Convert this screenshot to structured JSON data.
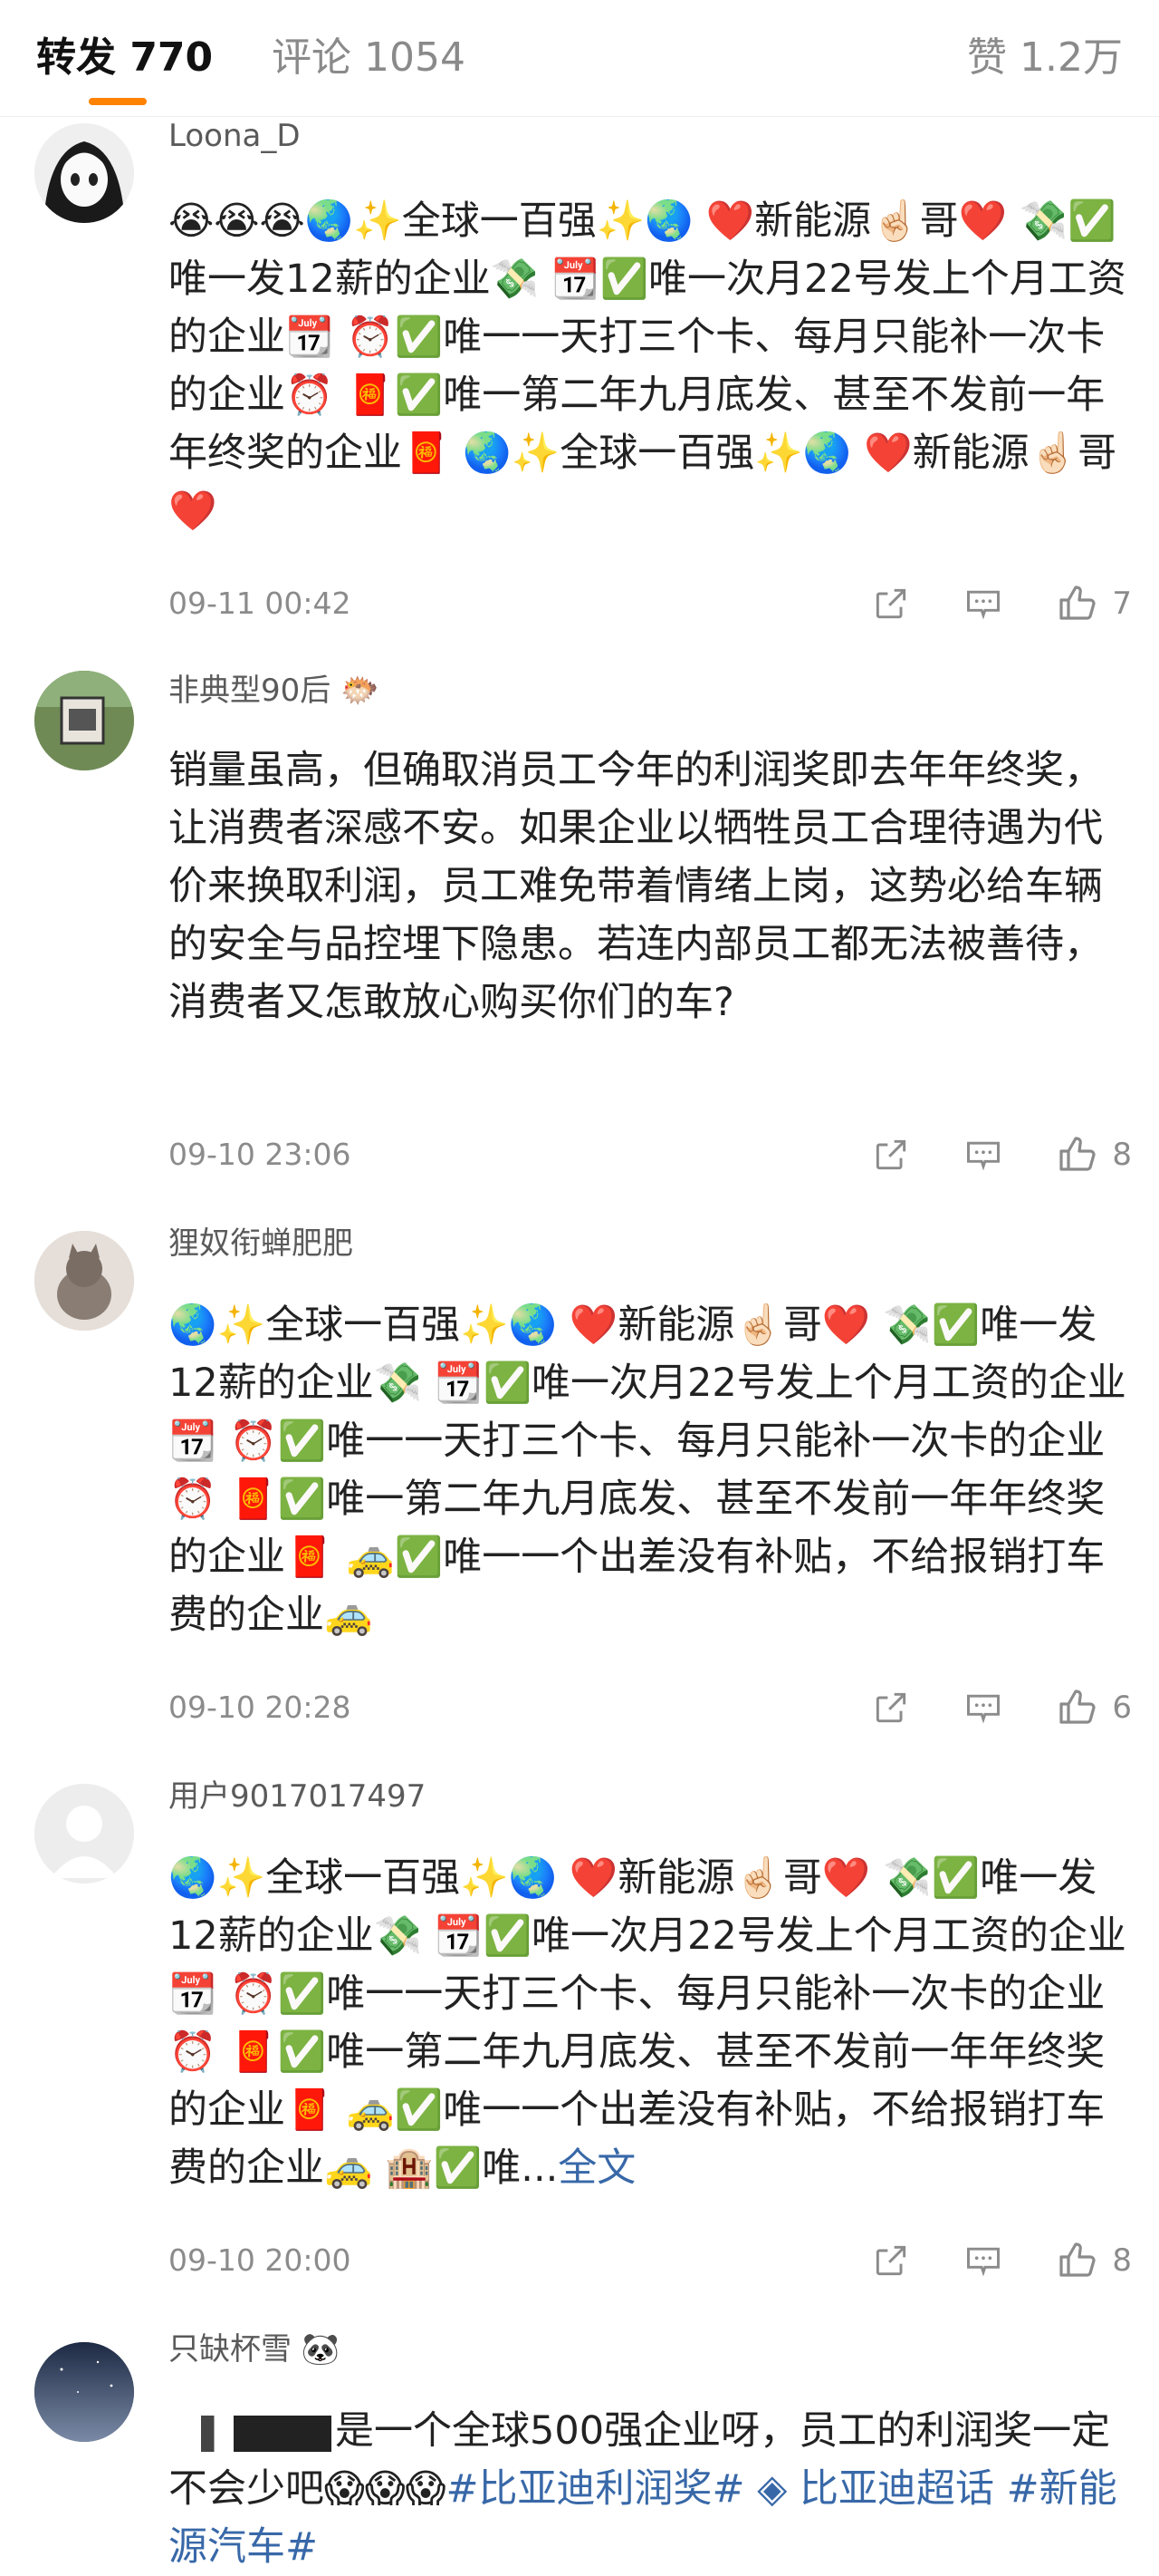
{
  "tabs": {
    "repost": "转发 770",
    "comment": "评论 1054",
    "like": "赞 1.2万"
  },
  "colors": {
    "accent": "#ff8200",
    "link": "#3868a8"
  },
  "comments": [
    {
      "username": "Loona_D",
      "avatar_icon": "anime-girl-avatar",
      "text": "😭😭😭🌏✨全球一百强✨🌏 ❤️新能源☝🏻哥❤️ 💸✅唯一发12薪的企业💸 📆✅唯一次月22号发上个月工资的企业📆 ⏰✅唯一一天打三个卡、每月只能补一次卡的企业⏰ 🧧✅唯一第二年九月底发、甚至不发前一年年终奖的企业🧧 🌏✨全球一百强✨🌏 ❤️新能源☝🏻哥❤️",
      "time": "09-11 00:42",
      "likes": "7"
    },
    {
      "username": "非典型90后 🐡",
      "avatar_icon": "photo-avatar",
      "text": "销量虽高，但确取消员工今年的利润奖即去年年终奖，让消费者深感不安。如果企业以牺牲员工合理待遇为代价来换取利润，员工难免带着情绪上岗，这势必给车辆的安全与品控埋下隐患。若连内部员工都无法被善待，消费者又怎敢放心购买你们的车?",
      "time": "09-10 23:06",
      "likes": "8"
    },
    {
      "username": "狸奴衔蝉肥肥",
      "avatar_icon": "cat-avatar",
      "text": "🌏✨全球一百强✨🌏 ❤️新能源☝🏻哥❤️ 💸✅唯一发12薪的企业💸 📆✅唯一次月22号发上个月工资的企业📆 ⏰✅唯一一天打三个卡、每月只能补一次卡的企业⏰ 🧧✅唯一第二年九月底发、甚至不发前一年年终奖的企业🧧 🚕✅唯一一个出差没有补贴，不给报销打车费的企业🚕",
      "time": "09-10 20:28",
      "likes": "6"
    },
    {
      "username": "用户9017017497",
      "avatar_icon": "default-user-avatar",
      "text": "🌏✨全球一百强✨🌏 ❤️新能源☝🏻哥❤️ 💸✅唯一发12薪的企业💸 📆✅唯一次月22号发上个月工资的企业📆 ⏰✅唯一一天打三个卡、每月只能补一次卡的企业⏰ 🧧✅唯一第二年九月底发、甚至不发前一年年终奖的企业🧧 🚕✅唯一一个出差没有补贴，不给报销打车费的企业🚕 🏨✅唯...",
      "full_text_link": "全文",
      "time": "09-10 20:00",
      "likes": "8"
    },
    {
      "username": "只缺杯雪 🐼",
      "avatar_icon": "night-sky-avatar",
      "text": "是一个全球500强企业呀，员工的利润奖一定不会少吧😱😱😱",
      "tags": [
        "#比亚迪利润奖#",
        "◈ 比亚迪超话",
        "#新能源汽车#"
      ]
    }
  ]
}
